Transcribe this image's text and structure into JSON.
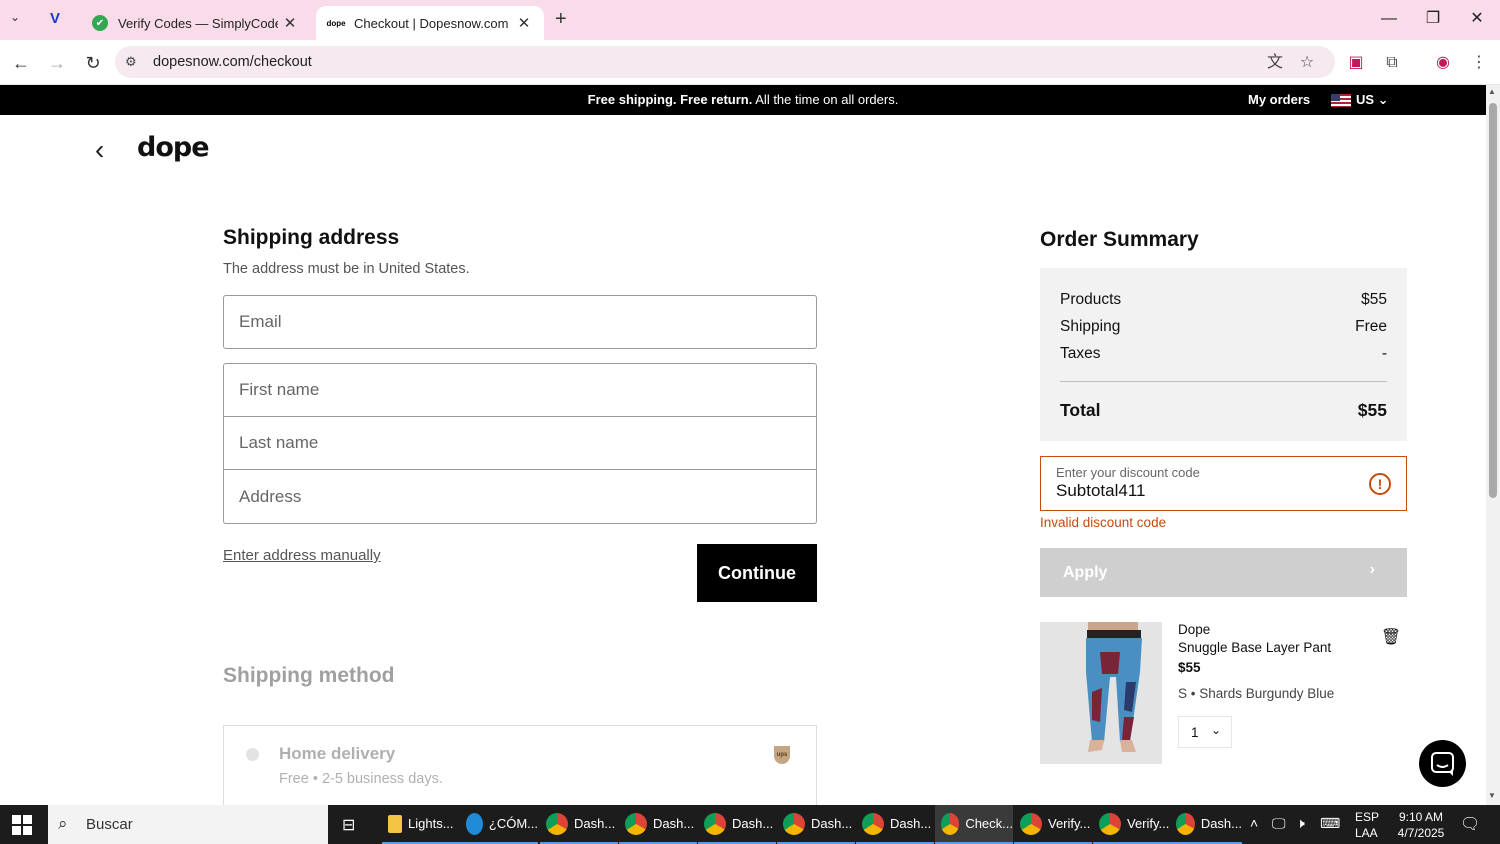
{
  "browser": {
    "tabs": [
      {
        "title": "Verify Codes — SimplyCodes",
        "active": false
      },
      {
        "title": "Checkout | Dopesnow.com",
        "active": true
      }
    ],
    "url": "dopesnow.com/checkout"
  },
  "promo": {
    "bold_text": "Free shipping. Free return.",
    "text": "All the time on all orders.",
    "my_orders": "My orders",
    "country": "US"
  },
  "logo": "dope",
  "shipping": {
    "title": "Shipping address",
    "subtitle": "The address must be in United States.",
    "email_placeholder": "Email",
    "first_name_placeholder": "First name",
    "last_name_placeholder": "Last name",
    "address_placeholder": "Address",
    "manual_link": "Enter address manually",
    "continue_label": "Continue"
  },
  "shipping_method": {
    "title": "Shipping method",
    "option_name": "Home delivery",
    "option_desc": "Free • 2-5 business days."
  },
  "summary": {
    "title": "Order Summary",
    "rows": [
      {
        "label": "Products",
        "value": "$55"
      },
      {
        "label": "Shipping",
        "value": "Free"
      },
      {
        "label": "Taxes",
        "value": "-"
      }
    ],
    "total_label": "Total",
    "total_value": "$55"
  },
  "discount": {
    "label": "Enter your discount code",
    "value": "Subtotal411",
    "error": "Invalid discount code",
    "apply_label": "Apply"
  },
  "product": {
    "brand": "Dope",
    "name": "Snuggle Base Layer Pant",
    "price": "$55",
    "variant": "S • Shards Burgundy Blue",
    "quantity": "1"
  },
  "taskbar": {
    "search_label": "Buscar",
    "items": [
      "Lights...",
      "¿CÓM...",
      "Dash...",
      "Dash...",
      "Dash...",
      "Dash...",
      "Dash...",
      "Check...",
      "Verify...",
      "Verify...",
      "Dash..."
    ],
    "lang_top": "ESP",
    "lang_bottom": "LAA",
    "time": "9:10 AM",
    "date": "4/7/2025"
  },
  "colors": {
    "accent_error": "#c64b0c",
    "tab_bar": "#f9dbea",
    "promo_bg": "#000000"
  }
}
